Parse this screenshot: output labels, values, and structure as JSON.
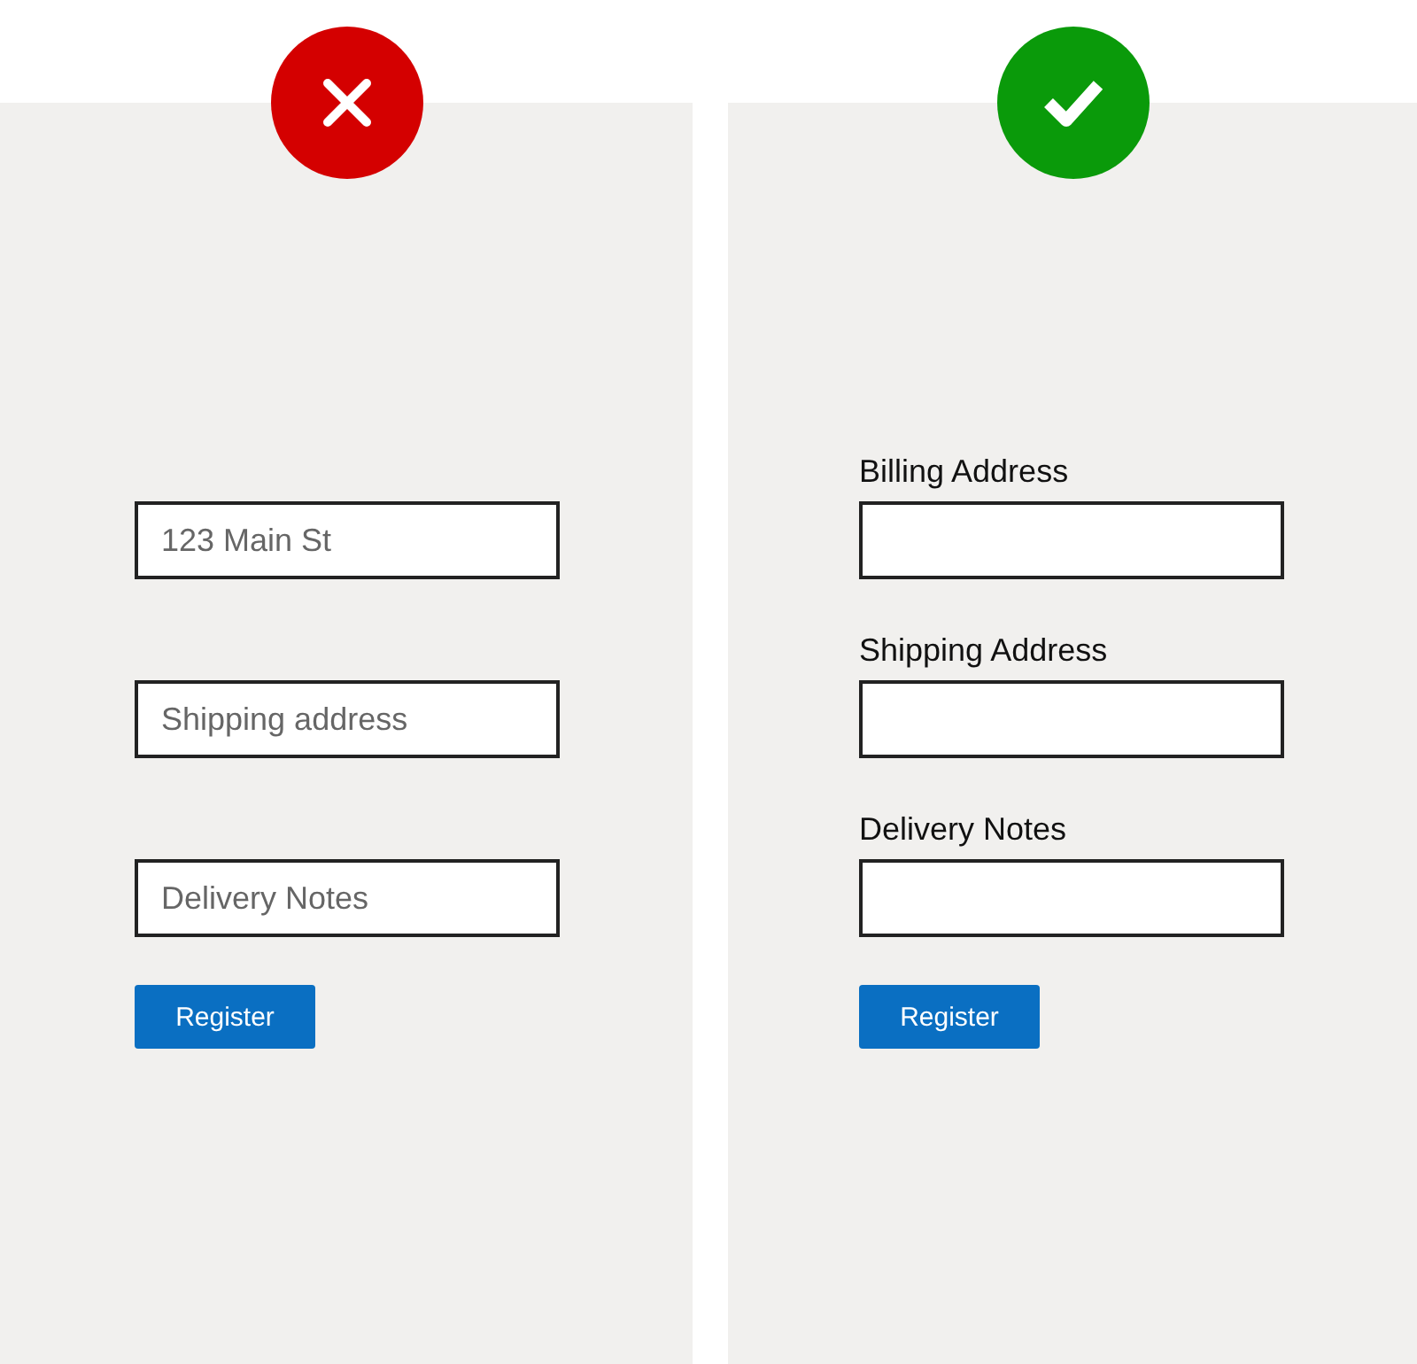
{
  "panels": [
    {
      "kind": "bad",
      "fields": [
        {
          "placeholder": "123 Main St"
        },
        {
          "placeholder": "Shipping address"
        },
        {
          "placeholder": "Delivery Notes"
        }
      ],
      "button": "Register"
    },
    {
      "kind": "good",
      "fields": [
        {
          "label": "Billing Address"
        },
        {
          "label": "Shipping Address"
        },
        {
          "label": "Delivery Notes"
        }
      ],
      "button": "Register"
    }
  ]
}
